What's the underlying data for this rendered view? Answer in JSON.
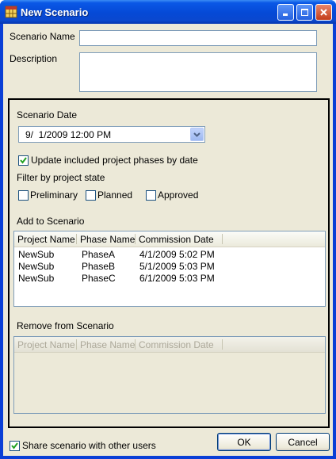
{
  "window": {
    "title": "New Scenario"
  },
  "fields": {
    "scenario_name_label": "Scenario Name",
    "scenario_name_value": "",
    "description_label": "Description",
    "description_value": ""
  },
  "scenario_date": {
    "label": "Scenario Date",
    "value": "9/  1/2009 12:00 PM"
  },
  "update_by_date": {
    "label": "Update included project phases by date",
    "checked": true
  },
  "filter": {
    "label": "Filter by project state",
    "options": [
      {
        "label": "Preliminary",
        "checked": false
      },
      {
        "label": "Planned",
        "checked": false
      },
      {
        "label": "Approved",
        "checked": false
      }
    ]
  },
  "add_list": {
    "label": "Add to Scenario",
    "columns": [
      "Project Name",
      "Phase Name",
      "Commission Date"
    ],
    "rows": [
      [
        "NewSub",
        "PhaseA",
        "4/1/2009 5:02 PM"
      ],
      [
        "NewSub",
        "PhaseB",
        "5/1/2009 5:03 PM"
      ],
      [
        "NewSub",
        "PhaseC",
        "6/1/2009 5:03 PM"
      ]
    ]
  },
  "remove_list": {
    "label": "Remove from Scenario",
    "columns": [
      "Project Name",
      "Phase Name",
      "Commission Date"
    ],
    "rows": []
  },
  "share": {
    "label": "Share scenario with other users",
    "checked": true
  },
  "buttons": {
    "ok": "OK",
    "cancel": "Cancel"
  },
  "colors": {
    "titlebar": "#0549d6",
    "client": "#ece9d8",
    "check": "#21a121"
  }
}
